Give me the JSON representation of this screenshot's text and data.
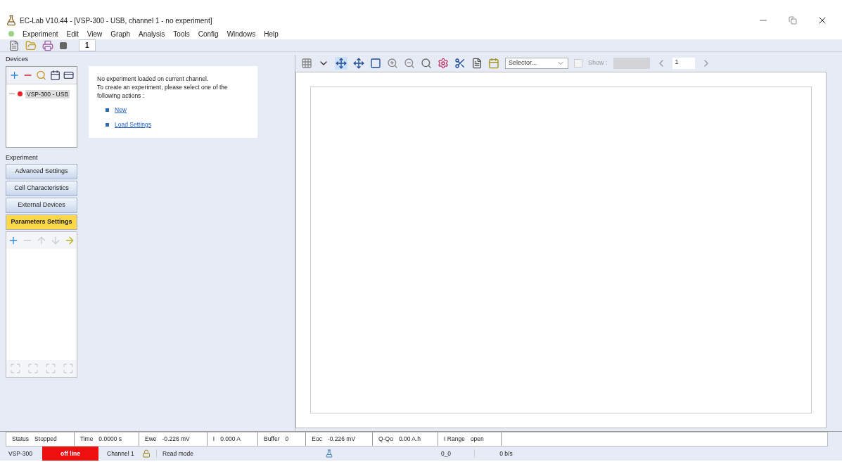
{
  "window": {
    "title": "EC-Lab V10.44 - [VSP-300 - USB, channel 1 - no experiment]"
  },
  "menu": [
    "Experiment",
    "Edit",
    "View",
    "Graph",
    "Analysis",
    "Tools",
    "Config",
    "Windows",
    "Help"
  ],
  "channel_tabs": [
    {
      "label": "1",
      "selected": true
    }
  ],
  "devices": {
    "label": "Devices",
    "items": [
      {
        "name": "VSP-300 - USB",
        "color": "#e8202a",
        "selected": true
      }
    ]
  },
  "experiment": {
    "label": "Experiment",
    "buttons": [
      {
        "label": "Advanced Settings",
        "selected": false
      },
      {
        "label": "Cell Characteristics",
        "selected": false
      },
      {
        "label": "External Devices",
        "selected": false
      },
      {
        "label": "Parameters Settings",
        "selected": true
      }
    ]
  },
  "message": {
    "lines": [
      "No experiment loaded on current channel.",
      "To create an experiment, please select one of the following actions :"
    ],
    "links": [
      "New",
      "Load Settings"
    ]
  },
  "graph_toolbar": {
    "selector": "Selector...",
    "show_label": "Show :",
    "show_checked": false,
    "page": "1"
  },
  "status_fields": [
    {
      "label": "Status",
      "value": "Stopped"
    },
    {
      "label": "Time",
      "value": "0.0000 s"
    },
    {
      "label": "Ewe",
      "value": "-0.226 mV"
    },
    {
      "label": "I",
      "value": "0.000 A"
    },
    {
      "label": "Buffer",
      "value": "0"
    },
    {
      "label": "Eoc",
      "value": "-0.226 mV"
    },
    {
      "label": "Q-Qo",
      "value": "0.00 A.h"
    },
    {
      "label": "I Range",
      "value": "open"
    }
  ],
  "bottom_bar": {
    "device": "VSP-300",
    "connection": "off line",
    "online": false,
    "channel": "Channel 1",
    "mode": "Read mode",
    "counter": "0_0",
    "rate": "0 b/s"
  }
}
